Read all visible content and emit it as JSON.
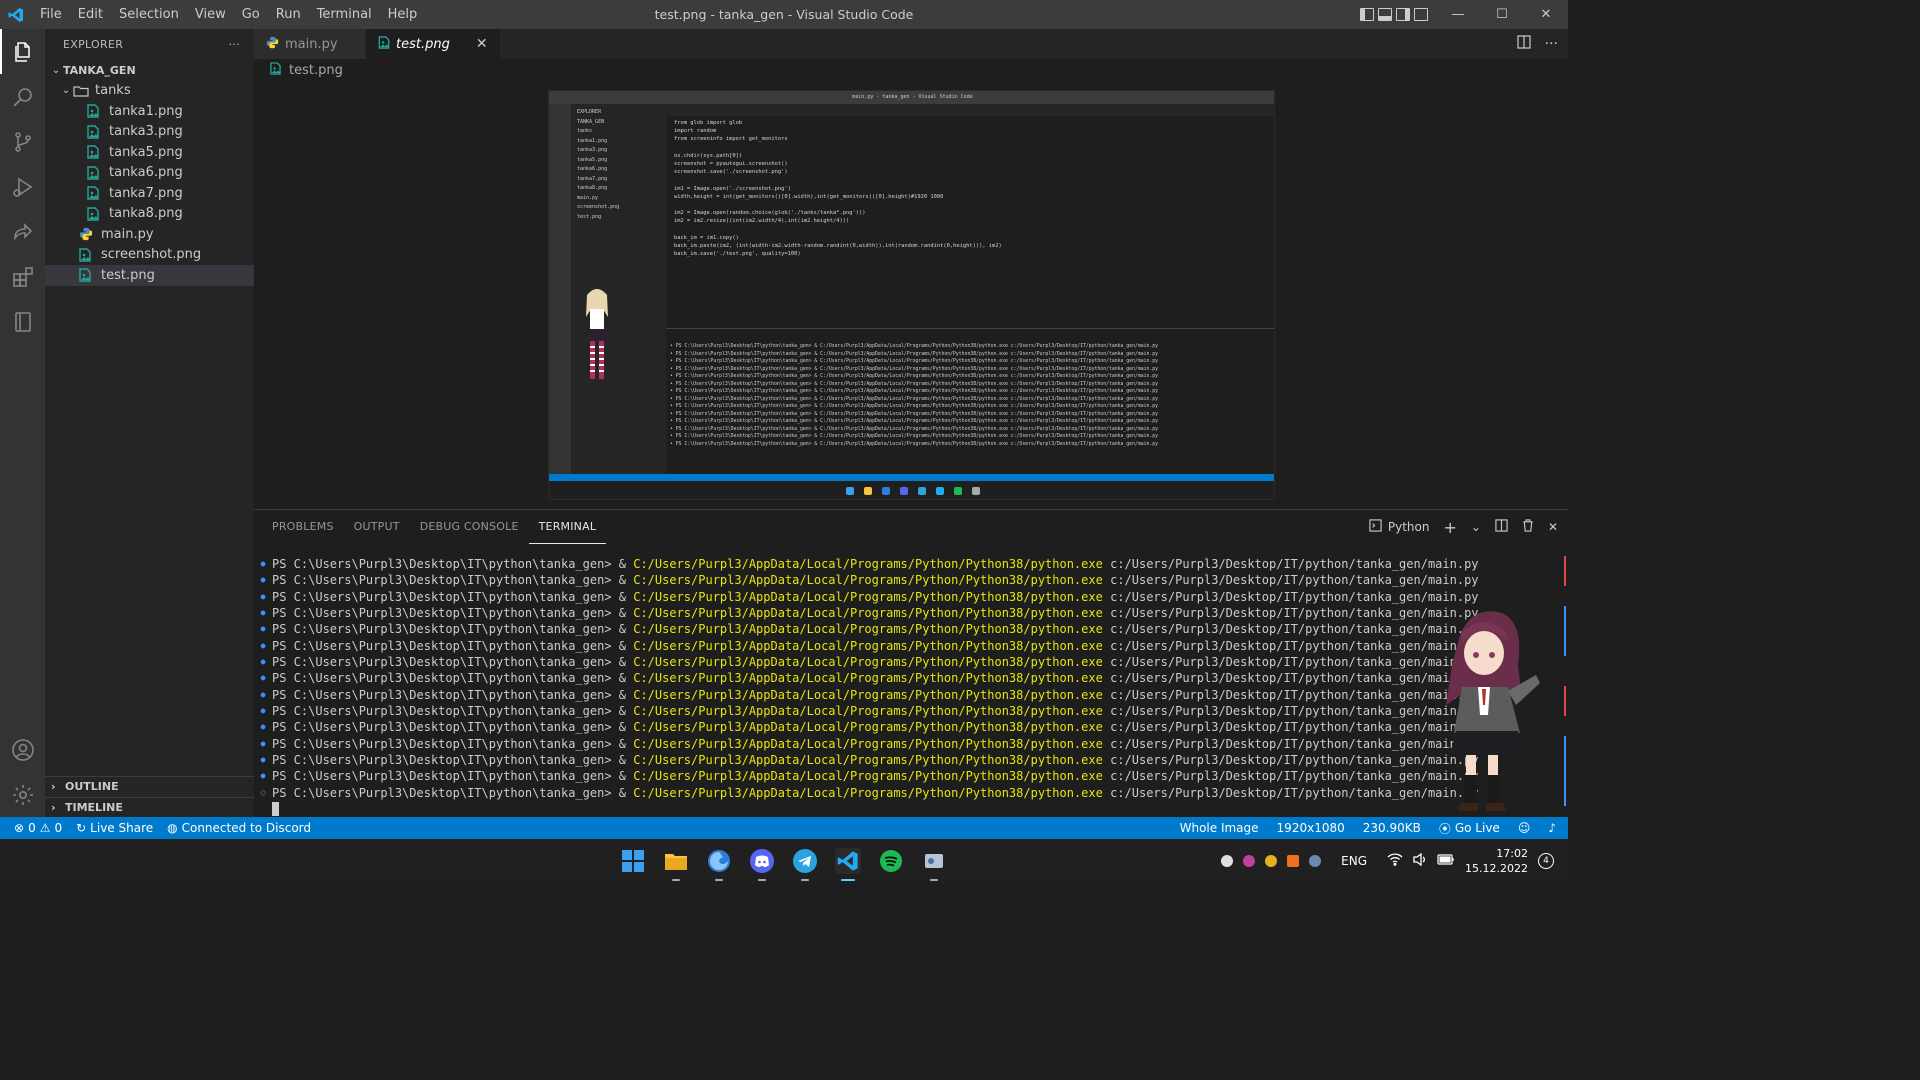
{
  "window": {
    "title": "test.png - tanka_gen - Visual Studio Code",
    "menu": [
      "File",
      "Edit",
      "Selection",
      "View",
      "Go",
      "Run",
      "Terminal",
      "Help"
    ],
    "controls": {
      "minimize": "—",
      "maximize": "☐",
      "close": "✕"
    }
  },
  "sidebar": {
    "header": "EXPLORER",
    "more": "···",
    "root": "TANKA_GEN",
    "folder": "tanks",
    "tank_files": [
      "tanka1.png",
      "tanka3.png",
      "tanka5.png",
      "tanka6.png",
      "tanka7.png",
      "tanka8.png"
    ],
    "root_files": [
      "main.py",
      "screenshot.png",
      "test.png"
    ],
    "selected": "test.png",
    "outline": "OUTLINE",
    "timeline": "TIMELINE"
  },
  "tabs": [
    {
      "label": "main.py",
      "active": false
    },
    {
      "label": "test.png",
      "active": true,
      "close": "✕"
    }
  ],
  "breadcrumb": "test.png",
  "panel": {
    "tabs": [
      "PROBLEMS",
      "OUTPUT",
      "DEBUG CONSOLE",
      "TERMINAL"
    ],
    "active_tab": "TERMINAL",
    "shell": "Python",
    "terminal": {
      "prompt": "PS C:\\Users\\Purpl3\\Desktop\\IT\\python\\tanka_gen> & ",
      "exe": "C:/Users/Purpl3/AppData/Local/Programs/Python/Python38/python.exe",
      "arg": " c:/Users/Purpl3/Desktop/IT/python/tanka_gen/main.py",
      "line_count": 15
    }
  },
  "statusbar": {
    "errors": "0",
    "warnings": "0",
    "live_share": "Live Share",
    "discord": "Connected to Discord",
    "image_mode": "Whole Image",
    "dimensions": "1920x1080",
    "size": "230.90KB",
    "go_live": "Go Live"
  },
  "taskbar": {
    "lang": "ENG",
    "time": "17:02",
    "date": "15.12.2022",
    "notifications": "4"
  },
  "preview": {
    "title": "main.py - tanka_gen - Visual Studio Code",
    "code": [
      "from glob import glob",
      "import random",
      "from screeninfo import get_monitors",
      "",
      "os.chdir(sys.path[0])",
      "screenshot = pyautogui.screenshot()",
      "screenshot.save('./screenshot.png')",
      "",
      "im1 = Image.open('./screenshot.png')",
      "width,height = int(get_monitors()[0].width),int(get_monitors()[0].height)#1920 1080",
      "",
      "im2 = Image.open(random.choice(glob('./tanks/tanka*.png')))",
      "im2 = im2.resize((int(im2.width/4),int(im2.height/4)))",
      "",
      "back_im = im1.copy()",
      "back_im.paste(im2, (int(width-im2.width-random.randint(0,width)),int(random.randint(0,height))), im2)",
      "back_im.save('./test.png', quality=100)"
    ],
    "files": [
      "EXPLORER",
      "TANKA_GEN",
      "tanks",
      "tanka1.png",
      "tanka3.png",
      "tanka5.png",
      "tanka6.png",
      "tanka7.png",
      "tanka8.png",
      "main.py",
      "screenshot.png",
      "test.png"
    ]
  }
}
